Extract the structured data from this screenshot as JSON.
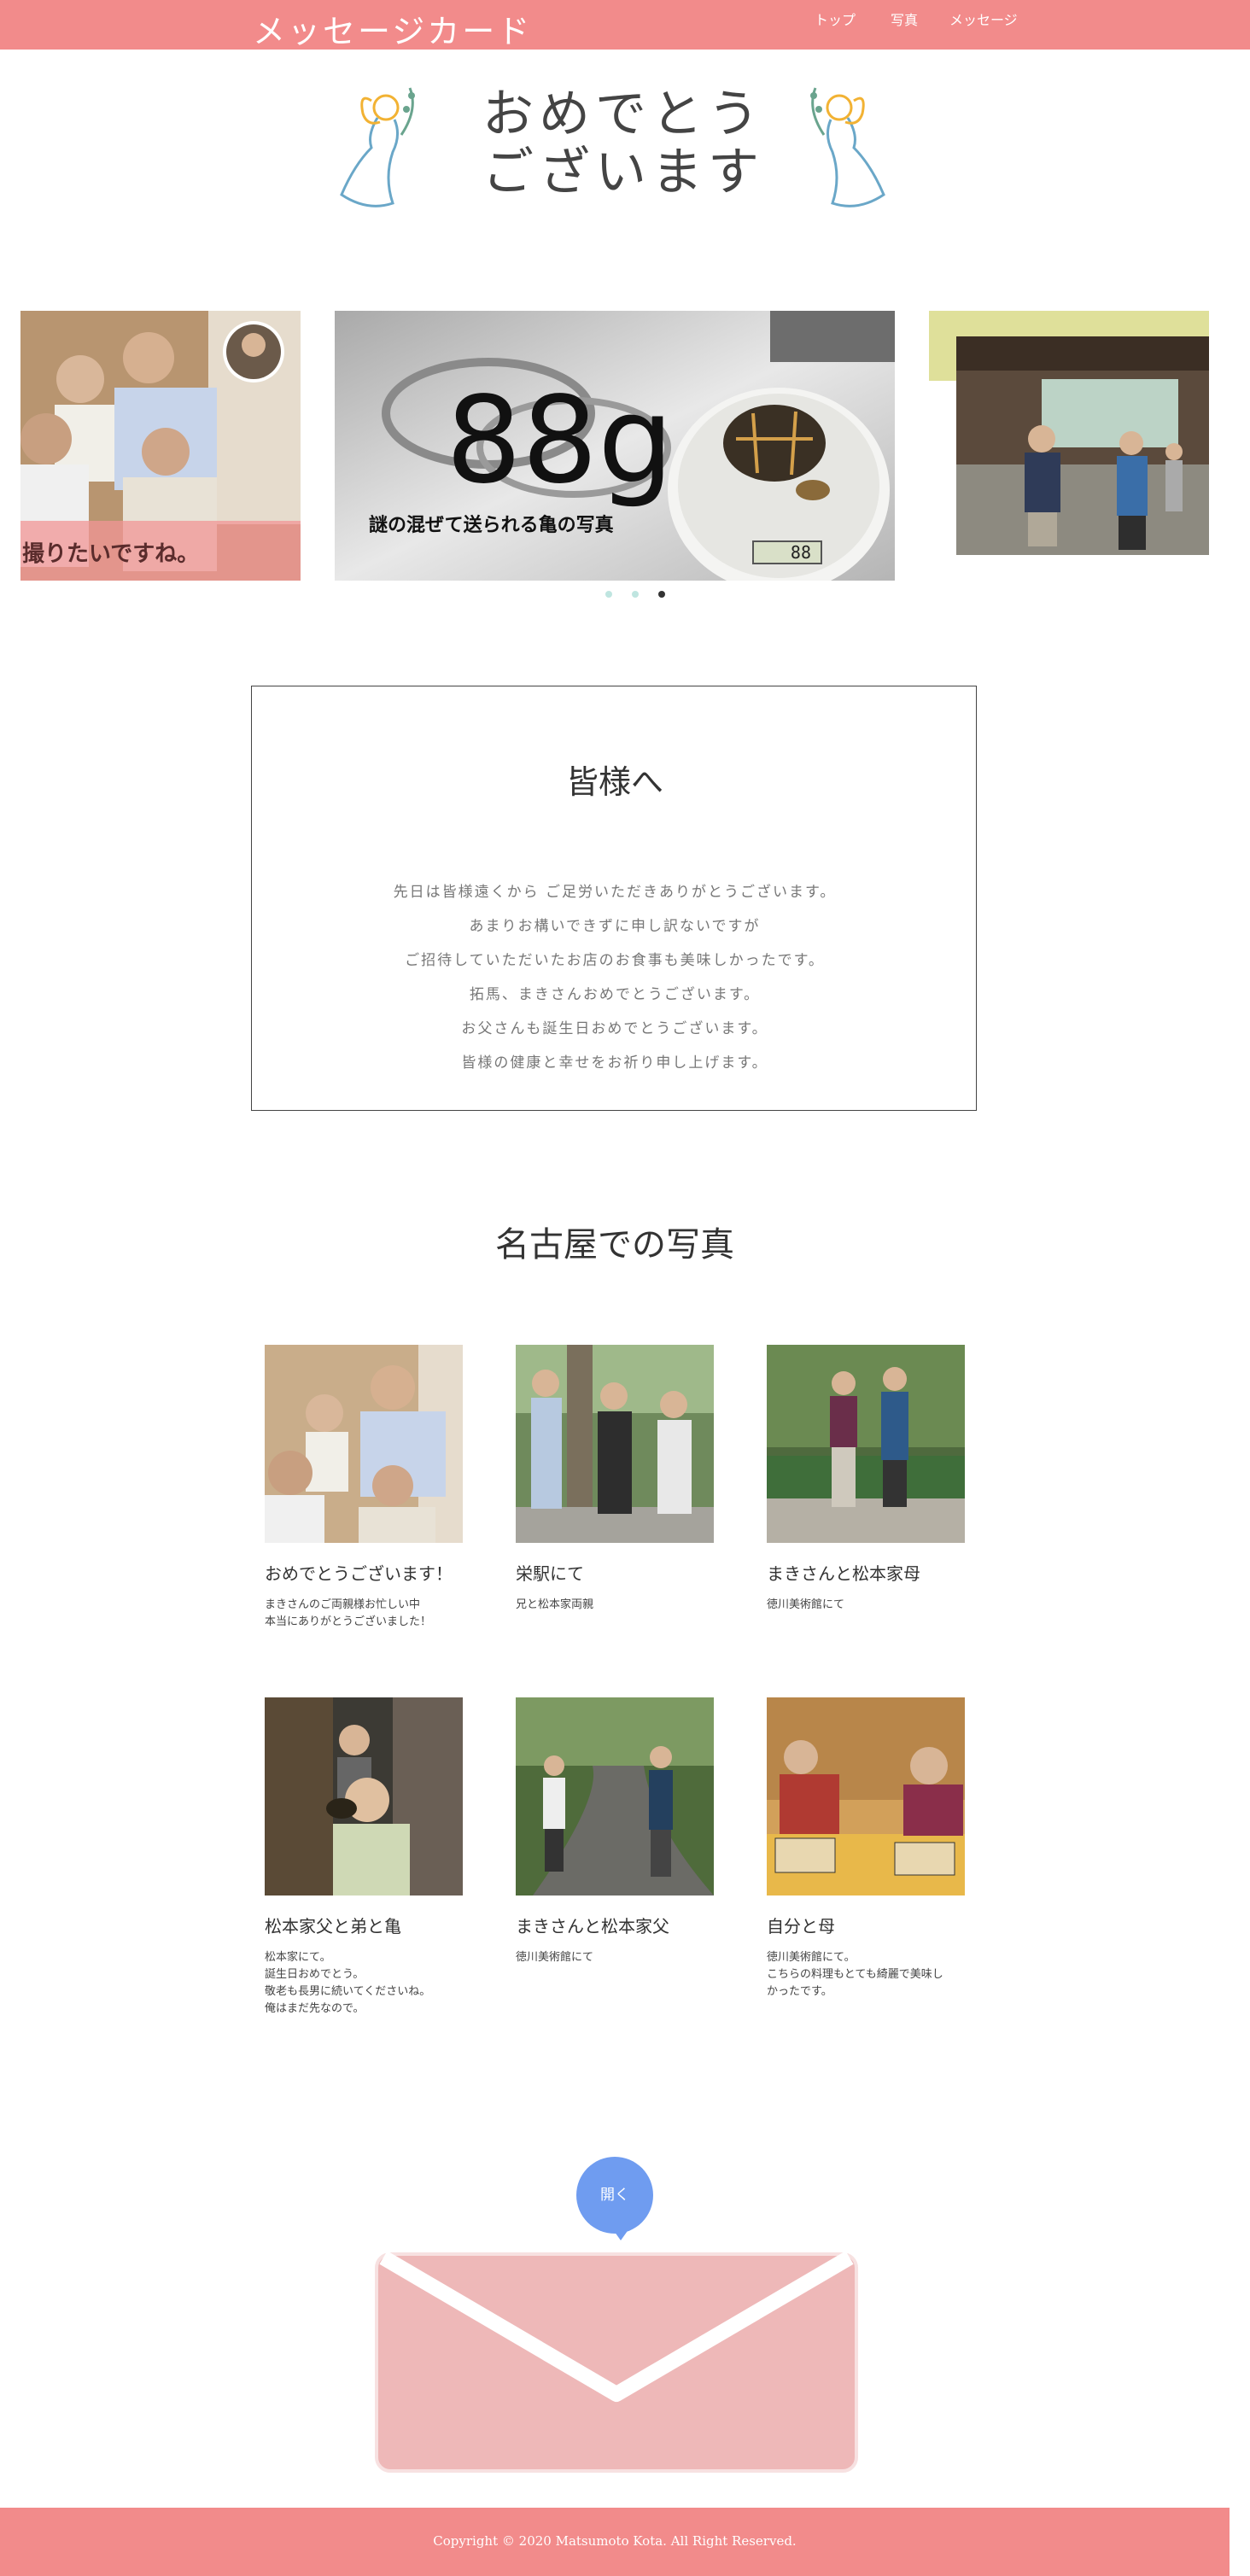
{
  "header": {
    "title": "メッセージカード",
    "nav": [
      "トップ",
      "写真",
      "メッセージ"
    ]
  },
  "hero": {
    "line1": "おめでとう",
    "line2": "ございます"
  },
  "slider": {
    "left_caption": "撮りたいですね。",
    "center_big_text": "88g",
    "center_subtext": "謎の混ぜて送られる亀の写真",
    "scale_reading": "88"
  },
  "message": {
    "heading": "皆様へ",
    "lines": [
      "先日は皆様遠くから ご足労いただきありがとうございます。",
      "あまりお構いできずに申し訳ないですが",
      "ご招待していただいたお店のお食事も美味しかったです。",
      "拓馬、まきさんおめでとうございます。",
      "お父さんも誕生日おめでとうございます。",
      "皆様の健康と幸せをお祈り申し上げます。"
    ]
  },
  "gallery": {
    "title": "名古屋での写真",
    "items": [
      {
        "title": "おめでとうございます！",
        "desc": "まきさんのご両親様お忙しい中\n本当にありがとうございました！"
      },
      {
        "title": "栄駅にて",
        "desc": "兄と松本家両親"
      },
      {
        "title": "まきさんと松本家母",
        "desc": "徳川美術館にて"
      },
      {
        "title": "松本家父と弟と亀",
        "desc": "松本家にて。\n誕生日おめでとう。\n敬老も長男に続いてくださいね。\n俺はまだ先なので。"
      },
      {
        "title": "まきさんと松本家父",
        "desc": "徳川美術館にて"
      },
      {
        "title": "自分と母",
        "desc": "徳川美術館にて。\nこちらの料理もとても綺麗で美味し\nかったです。"
      }
    ]
  },
  "envelope": {
    "open_label": "開く"
  },
  "footer": {
    "copyright": "Copyright © 2020 Matsumoto Kota. All Right Reserved."
  },
  "colors": {
    "brand": "#f28b8b",
    "button": "#6f9cf0",
    "envelope": "#eeb8b8",
    "accent_yellow": "#dfe09a"
  }
}
